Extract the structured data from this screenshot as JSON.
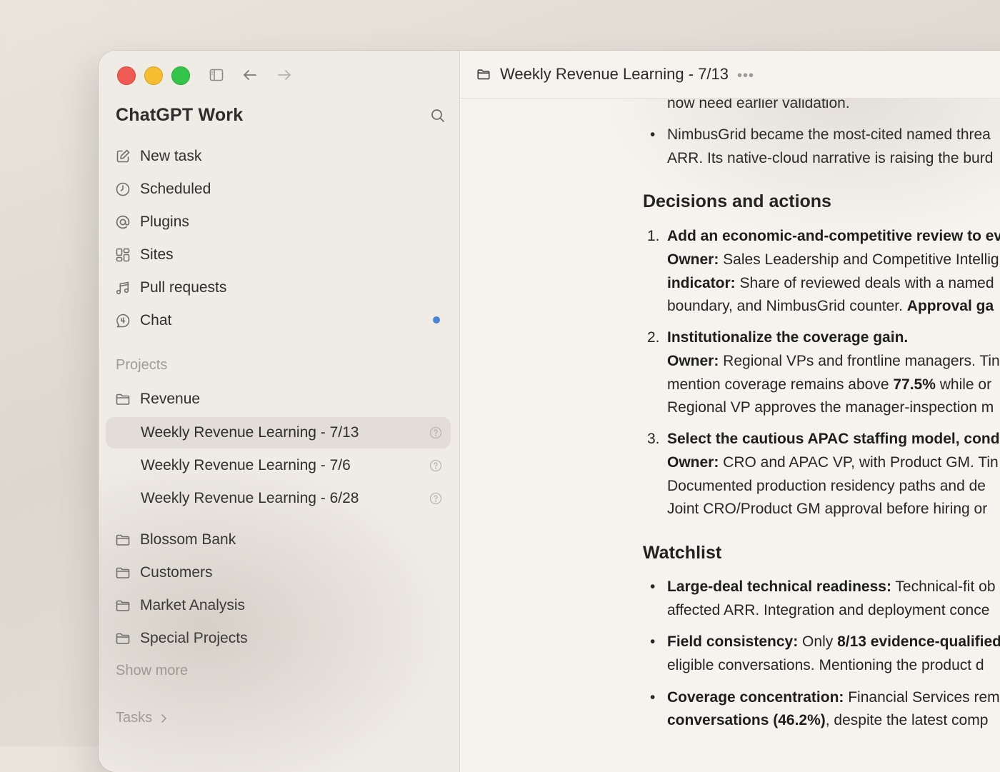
{
  "sidebar": {
    "app_title": "ChatGPT Work",
    "nav": [
      {
        "label": "New task",
        "icon": "compose-icon"
      },
      {
        "label": "Scheduled",
        "icon": "clock-icon"
      },
      {
        "label": "Plugins",
        "icon": "at-sign-icon"
      },
      {
        "label": "Sites",
        "icon": "grid-icon"
      },
      {
        "label": "Pull requests",
        "icon": "pull-request-icon"
      },
      {
        "label": "Chat",
        "icon": "chat-icon",
        "unread": true
      }
    ],
    "projects_label": "Projects",
    "projects": [
      {
        "label": "Revenue",
        "tasks": [
          {
            "label": "Weekly Revenue Learning - 7/13",
            "active": true
          },
          {
            "label": "Weekly Revenue Learning - 7/6"
          },
          {
            "label": "Weekly Revenue Learning - 6/28"
          }
        ]
      },
      {
        "label": "Blossom Bank"
      },
      {
        "label": "Customers"
      },
      {
        "label": "Market Analysis"
      },
      {
        "label": "Special Projects"
      }
    ],
    "show_more": "Show more",
    "tasks_label": "Tasks"
  },
  "main": {
    "title": "Weekly Revenue Learning - 7/13",
    "more": "•••",
    "top_line": "now need earlier validation.",
    "bullet1": [
      "NimbusGrid became the most-cited named threa",
      "ARR. Its native-cloud narrative is raising the burd"
    ],
    "h_decisions": "Decisions and actions",
    "item1": {
      "num": "1.",
      "title": "Add an economic-and-competitive review to ev",
      "owner_label": "Owner:",
      "owner_text": " Sales Leadership and Competitive Intellig",
      "indicator_label": "indicator:",
      "indicator_text": " Share of reviewed deals with a named",
      "line4_text": "boundary, and NimbusGrid counter. ",
      "line4_bold": "Approval ga"
    },
    "item2": {
      "num": "2.",
      "title": "Institutionalize the coverage gain.",
      "owner_label": "Owner:",
      "owner_text": " Regional VPs and frontline managers. Tin",
      "line3_a": "mention coverage remains above ",
      "line3_b": "77.5%",
      "line3_c": " while or",
      "line4": "Regional VP approves the manager-inspection m"
    },
    "item3": {
      "num": "3.",
      "title": "Select the cautious APAC staffing model, cond",
      "owner_label": "Owner:",
      "owner_text": " CRO and APAC VP, with Product GM. Tin",
      "line3": "Documented production residency paths and de",
      "line4": "Joint CRO/Product GM approval before hiring or"
    },
    "h_watchlist": "Watchlist",
    "w1": {
      "label": "Large-deal technical readiness:",
      "text": " Technical-fit ob",
      "line2": "affected ARR. Integration and deployment conce"
    },
    "w2": {
      "label": "Field consistency:",
      "text": " Only ",
      "bold2": "8/13 evidence-qualified",
      "line2": "eligible conversations. Mentioning the product d"
    },
    "w3": {
      "label": "Coverage concentration:",
      "text": " Financial Services rem",
      "line2_bold": "conversations (46.2%)",
      "line2_text": ", despite the latest comp"
    }
  }
}
